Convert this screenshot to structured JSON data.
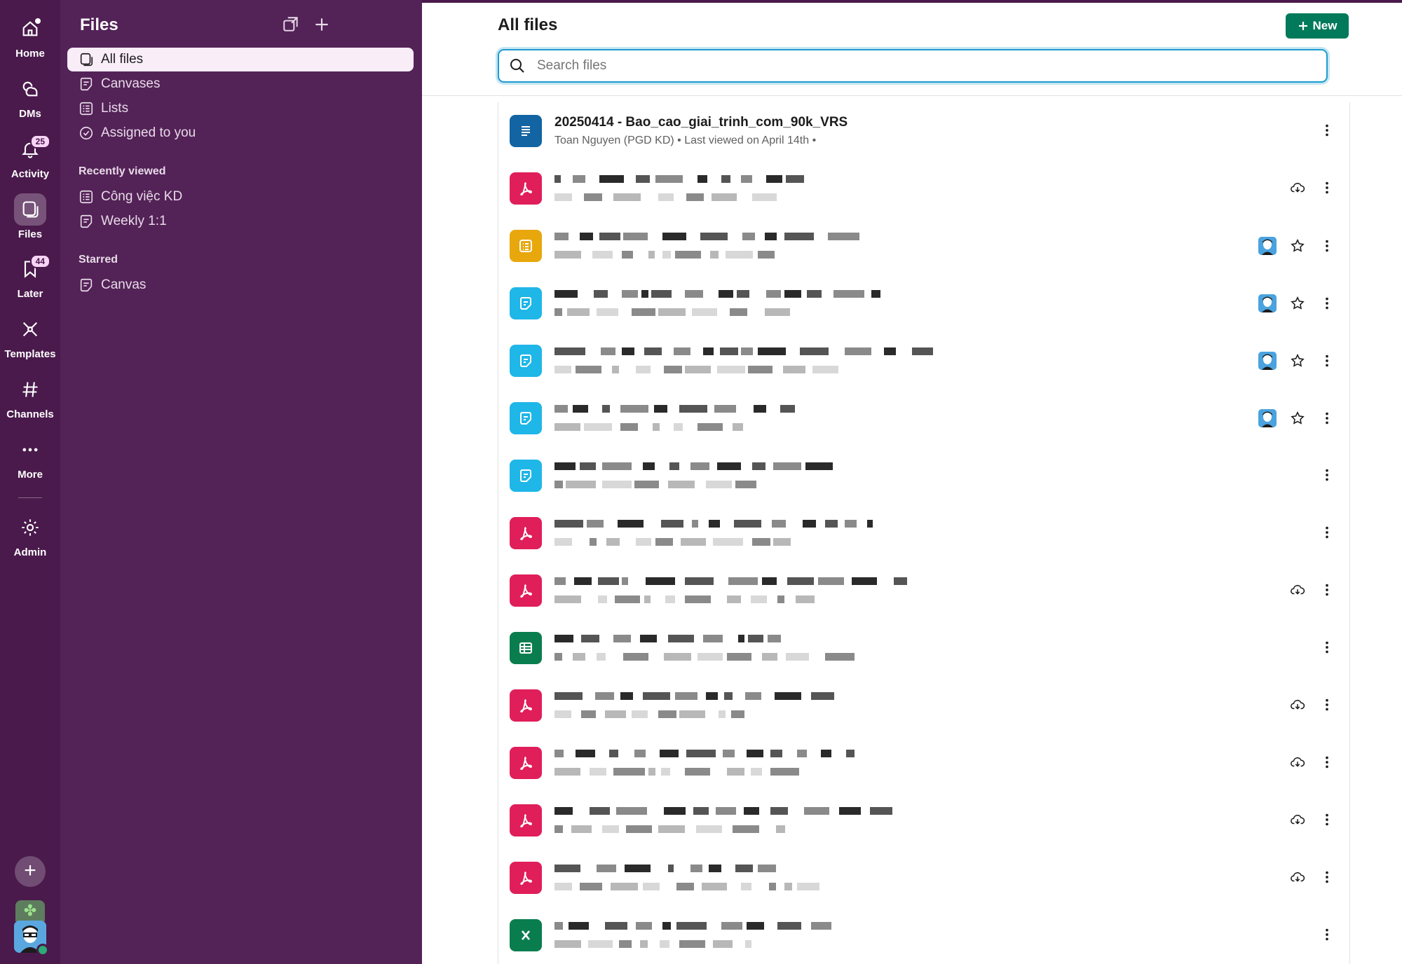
{
  "rail": {
    "items": [
      {
        "key": "home",
        "label": "Home",
        "icon": "home-icon"
      },
      {
        "key": "dms",
        "label": "DMs",
        "icon": "dms-icon"
      },
      {
        "key": "activity",
        "label": "Activity",
        "icon": "bell-icon",
        "badge": "25"
      },
      {
        "key": "files",
        "label": "Files",
        "icon": "files-icon",
        "active": true
      },
      {
        "key": "later",
        "label": "Later",
        "icon": "bookmark-icon",
        "badge": "44"
      },
      {
        "key": "templates",
        "label": "Templates",
        "icon": "templates-icon"
      },
      {
        "key": "channels",
        "label": "Channels",
        "icon": "hash-icon"
      },
      {
        "key": "more",
        "label": "More",
        "icon": "more-icon"
      },
      {
        "key": "admin",
        "label": "Admin",
        "icon": "gear-icon"
      }
    ],
    "add_label": "+"
  },
  "sidebar": {
    "title": "Files",
    "nav": [
      {
        "label": "All files",
        "icon": "files-icon",
        "active": true
      },
      {
        "label": "Canvases",
        "icon": "canvas-icon"
      },
      {
        "label": "Lists",
        "icon": "list-icon"
      },
      {
        "label": "Assigned to you",
        "icon": "check-circle-icon"
      }
    ],
    "recent_heading": "Recently viewed",
    "recent": [
      {
        "label": "Công việc KD",
        "icon": "list-icon"
      },
      {
        "label": "Weekly 1:1",
        "icon": "canvas-icon"
      }
    ],
    "starred_heading": "Starred",
    "starred": [
      {
        "label": "Canvas",
        "icon": "canvas-icon"
      }
    ]
  },
  "main": {
    "title": "All files",
    "new_button": "New",
    "search_placeholder": "Search files",
    "files": [
      {
        "type": "doc",
        "name": "20250414 - Bao_cao_giai_trinh_com_90k_VRS",
        "meta": "Toan Nguyen (PGD KD) • Last viewed on April 14th •",
        "actions": [
          "more"
        ]
      },
      {
        "type": "pdf",
        "name": "",
        "meta": "",
        "actions": [
          "download",
          "more"
        ]
      },
      {
        "type": "list",
        "name": "",
        "meta": "",
        "actions": [
          "avatar",
          "star",
          "more"
        ]
      },
      {
        "type": "canvas",
        "name": "",
        "meta": "",
        "actions": [
          "avatar",
          "star",
          "more"
        ]
      },
      {
        "type": "canvas",
        "name": "",
        "meta": "",
        "actions": [
          "avatar",
          "star",
          "more"
        ]
      },
      {
        "type": "canvas",
        "name": "",
        "meta": "",
        "actions": [
          "avatar",
          "star",
          "more"
        ]
      },
      {
        "type": "canvas",
        "name": "",
        "meta": "",
        "actions": [
          "more"
        ]
      },
      {
        "type": "pdf",
        "name": "",
        "meta": "",
        "actions": [
          "more"
        ]
      },
      {
        "type": "pdf",
        "name": "",
        "meta": "",
        "actions": [
          "download",
          "more"
        ]
      },
      {
        "type": "sheet",
        "name": "",
        "meta": "",
        "actions": [
          "more"
        ]
      },
      {
        "type": "pdf",
        "name": "",
        "meta": "",
        "actions": [
          "download",
          "more"
        ]
      },
      {
        "type": "pdf",
        "name": "",
        "meta": "",
        "actions": [
          "download",
          "more"
        ]
      },
      {
        "type": "pdf",
        "name": "",
        "meta": "",
        "actions": [
          "download",
          "more"
        ]
      },
      {
        "type": "pdf",
        "name": "",
        "meta": "",
        "actions": [
          "download",
          "more"
        ]
      },
      {
        "type": "excel",
        "name": "",
        "meta": "",
        "actions": [
          "more"
        ]
      }
    ]
  },
  "colors": {
    "rail_bg": "#4a1a4c",
    "sidebar_bg": "#532257",
    "active_item_bg": "#f9edf8",
    "accent_green": "#007a5a",
    "pdf": "#e01e5a",
    "list": "#e8a70c",
    "canvas": "#1fb6e8",
    "doc": "#1264a3",
    "sheet": "#0a7d4f"
  }
}
